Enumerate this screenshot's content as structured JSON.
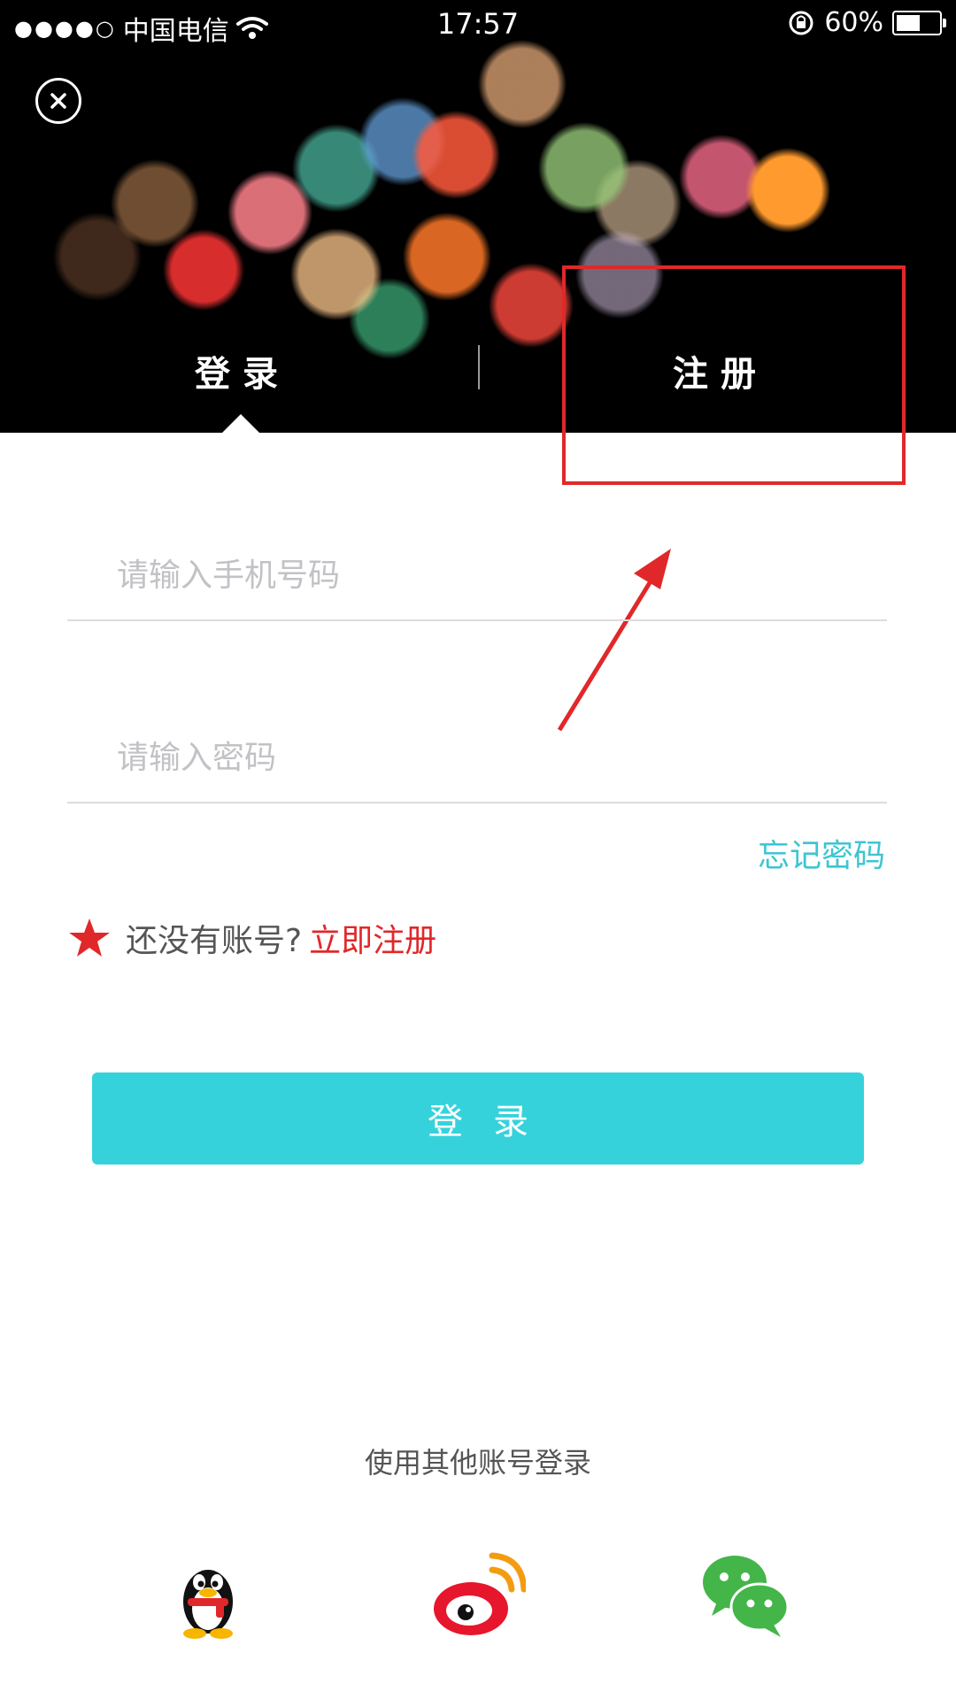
{
  "status_bar": {
    "signal_dots": "●●●●○",
    "carrier": "中国电信",
    "time": "17:57",
    "battery": "60%",
    "battery_level": 0.6
  },
  "tabs": [
    {
      "label": "登录",
      "active": true
    },
    {
      "label": "注册",
      "active": false
    }
  ],
  "form": {
    "phone_placeholder": "请输入手机号码",
    "password_placeholder": "请输入密码",
    "forgot_label": "忘记密码",
    "signup_prompt": "还没有账号?",
    "signup_link": "立即注册",
    "login_button": "登录"
  },
  "other_login": {
    "label": "使用其他账号登录",
    "providers": [
      "qq",
      "weibo",
      "wechat"
    ]
  },
  "icons": {
    "close": "close-icon",
    "star": "star-icon",
    "qq": "qq-icon",
    "weibo": "weibo-icon",
    "wechat": "wechat-icon",
    "wifi": "wifi-icon",
    "lock": "rotation-lock-icon",
    "battery": "battery-icon"
  },
  "colors": {
    "accent": "#36d2dc",
    "link": "#3cc6d2",
    "highlight": "#e0282a"
  }
}
